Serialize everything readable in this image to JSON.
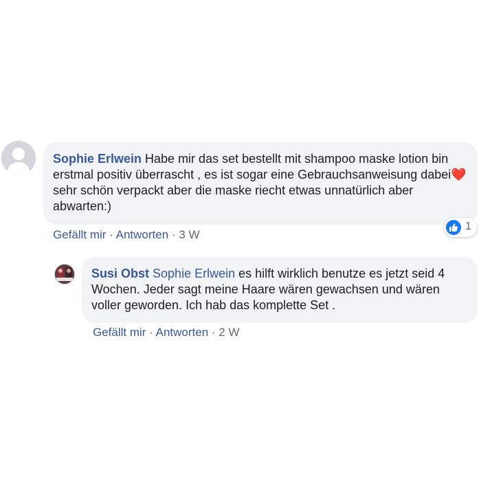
{
  "comments": [
    {
      "author": "Sophie Erlwein",
      "text_part1": " Habe mir das set bestellt mit shampoo maske lotion bin erstmal positiv überrascht , es ist sogar eine Gebrauchsanweisung dabei",
      "heart": "❤️",
      "text_part2": " sehr schön verpackt aber die maske riecht etwas unnatürlich aber abwarten:)",
      "like_label": "Gefällt mir",
      "separator": " · ",
      "reply_label": "Antworten",
      "time": "3 W",
      "reaction_icon": "thumbs-up-icon",
      "reaction_count": "1"
    },
    {
      "author": "Susi Obst",
      "mention": "Sophie Erlwein",
      "text": " es hilft wirklich benutze es jetzt seid 4 Wochen. Jeder sagt meine Haare wären gewachsen und wären voller geworden. Ich hab das komplette Set .",
      "like_label": "Gefällt mir",
      "separator": " · ",
      "reply_label": "Antworten",
      "time": "2 W"
    }
  ],
  "colors": {
    "link": "#385898",
    "bubble": "#f2f3f5",
    "meta": "#606770",
    "like_blue": "#1877f2"
  }
}
